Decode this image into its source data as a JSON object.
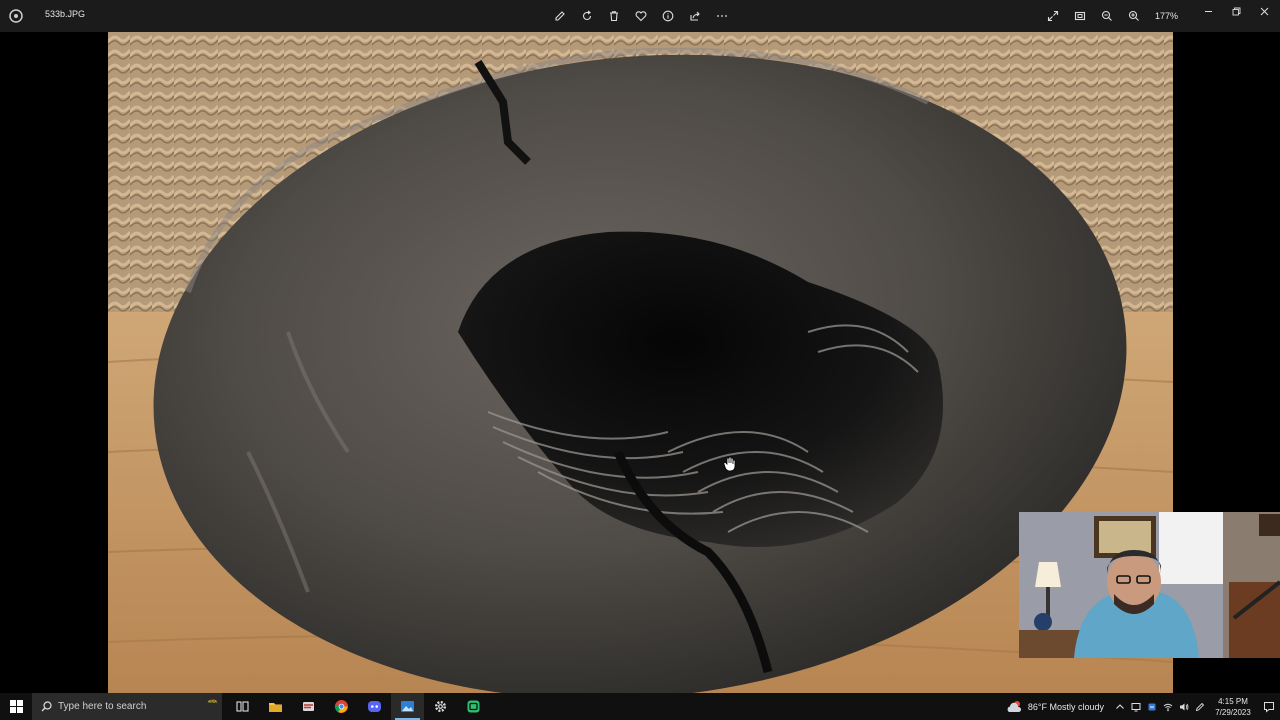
{
  "titlebar": {
    "file_name": "533b.JPG",
    "zoom_level": "177%",
    "center_tools": [
      "edit-icon",
      "rotate-icon",
      "delete-icon",
      "favorite-icon",
      "info-icon",
      "share-icon",
      "more-icon"
    ],
    "right_tools": [
      "fullscreen-icon",
      "actual-size-icon",
      "zoom-out-icon",
      "zoom-in-icon"
    ]
  },
  "taskbar": {
    "search_placeholder": "Type here to search",
    "apps": [
      "task-view",
      "file-explorer",
      "app",
      "chrome",
      "discord",
      "photos",
      "settings",
      "obs"
    ],
    "weather": "86°F  Mostly cloudy",
    "time": "4:15 PM",
    "date": "7/29/2023"
  },
  "colors": {
    "titlebar_bg": "#1b1b1b",
    "taskbar_bg": "#101010",
    "accent": "#76b9ed"
  }
}
